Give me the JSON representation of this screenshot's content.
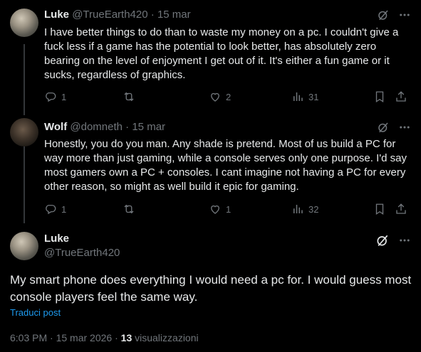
{
  "tweets": [
    {
      "name": "Luke",
      "handle": "@TrueEarth420",
      "sep": "·",
      "date": "15 mar",
      "text": "I have better things to do than to waste my money on a pc.  I couldn't give a fuck less if a game has the potential to look better, has absolutely zero bearing on the level of enjoyment I get out of it.  It's either a fun game or it sucks, regardless of graphics.",
      "replies": "1",
      "retweets": "",
      "likes": "2",
      "views": "31"
    },
    {
      "name": "Wolf",
      "handle": "@domneth",
      "sep": "·",
      "date": "15 mar",
      "text": "Honestly, you do you man. Any shade is pretend. Most of us build a PC for way more than just gaming, while a console serves only one purpose. I'd say most gamers own a PC + consoles. I cant imagine not having a PC for every other reason, so might as well build it epic for gaming.",
      "replies": "1",
      "retweets": "",
      "likes": "1",
      "views": "32"
    }
  ],
  "main": {
    "name": "Luke",
    "handle": "@TrueEarth420",
    "text": "My smart phone does everything I would need a pc for.  I would guess most console players feel the same way.",
    "translate": "Traduci post",
    "time": "6:03 PM",
    "sep1": "·",
    "date": "15 mar 2026",
    "sep2": "·",
    "views_count": "13",
    "views_label": "visualizzazioni"
  },
  "icons": {
    "grok": "grok-icon",
    "more": "more-icon",
    "reply": "reply-icon",
    "retweet": "retweet-icon",
    "like": "like-icon",
    "views": "views-icon",
    "bookmark": "bookmark-icon",
    "share": "share-icon"
  }
}
